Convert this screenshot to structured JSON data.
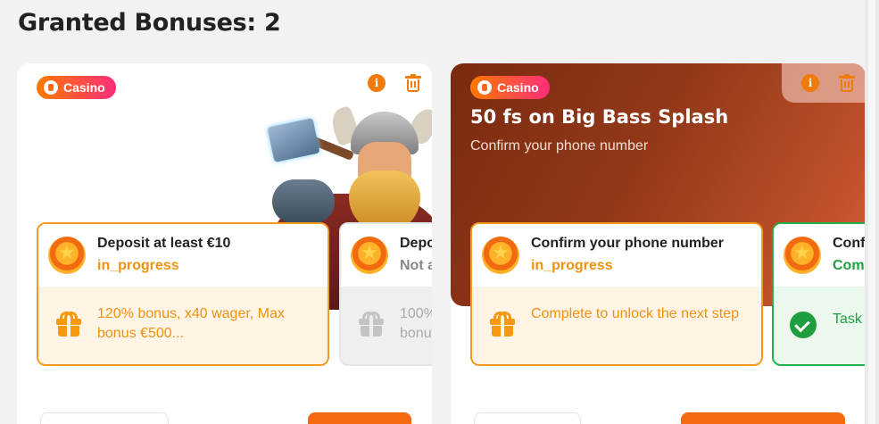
{
  "page": {
    "title": "Granted Bonuses: 2"
  },
  "cards": [
    {
      "tag": "Casino",
      "tasks": [
        {
          "title": "Deposit at least €10",
          "status": "in_progress",
          "description": "120% bonus, x40 wager, Max bonus €500..."
        },
        {
          "title": "Depo",
          "status": "Not a",
          "description": "100% bonu"
        }
      ]
    },
    {
      "tag": "Casino",
      "title": "50 fs on Big Bass Splash",
      "subtitle": "Confirm your phone number",
      "tasks": [
        {
          "title": "Confirm your phone number",
          "status": "in_progress",
          "description": "Complete to unlock the next step"
        },
        {
          "title": "Conf",
          "status": "Com",
          "description": "Task"
        }
      ]
    }
  ],
  "icons": {
    "info": "i",
    "trash": "trash-icon",
    "coin": "coin-icon",
    "gift": "gift-icon",
    "check": "check-icon"
  },
  "colors": {
    "accent": "#f39a1d",
    "success": "#21b34a",
    "banner": "#93391a"
  }
}
